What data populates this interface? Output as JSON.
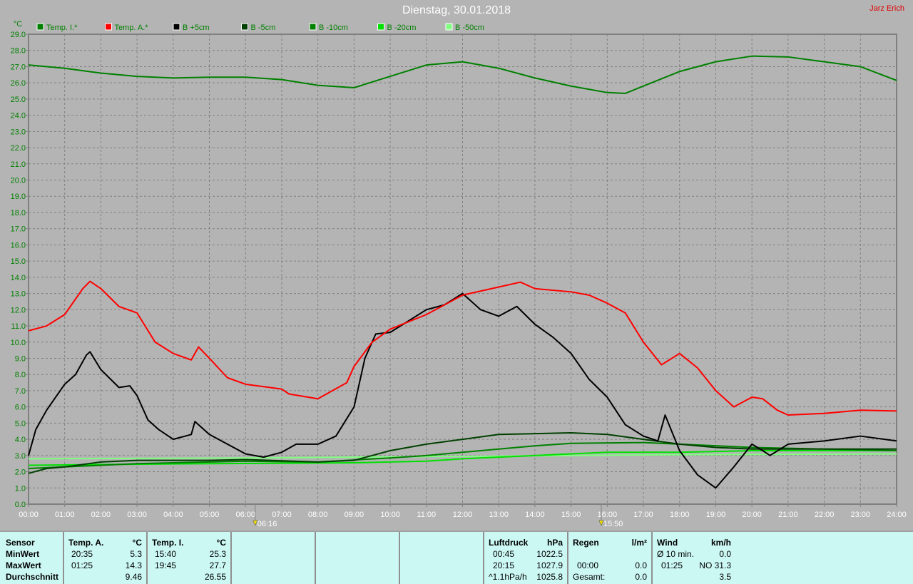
{
  "title": "Dienstag, 30.01.2018",
  "author": "Jarz Erich",
  "chart_data": {
    "type": "line",
    "ylabel": "°C",
    "ylim": [
      0,
      29
    ],
    "xlim": [
      0,
      24
    ],
    "yticks": [
      "0.0",
      "1.0",
      "2.0",
      "3.0",
      "4.0",
      "5.0",
      "6.0",
      "7.0",
      "8.0",
      "9.0",
      "10.0",
      "11.0",
      "12.0",
      "13.0",
      "14.0",
      "15.0",
      "16.0",
      "17.0",
      "18.0",
      "19.0",
      "20.0",
      "21.0",
      "22.0",
      "23.0",
      "24.0",
      "25.0",
      "26.0",
      "27.0",
      "28.0",
      "29.0"
    ],
    "xticks": [
      "00:00",
      "01:00",
      "02:00",
      "03:00",
      "04:00",
      "05:00",
      "06:00",
      "07:00",
      "08:00",
      "09:00",
      "10:00",
      "11:00",
      "12:00",
      "13:00",
      "14:00",
      "15:00",
      "16:00",
      "17:00",
      "18:00",
      "19:00",
      "20:00",
      "21:00",
      "22:00",
      "23:00",
      "24:00"
    ],
    "grid": true,
    "legend_position": "top",
    "markers": [
      {
        "label": "06:16",
        "x": 6.267,
        "type": "sunrise"
      },
      {
        "label": "15:50",
        "x": 15.833,
        "type": "sunset"
      }
    ],
    "series": [
      {
        "name": "Temp. I.*",
        "color": "#008000",
        "points": [
          [
            0,
            27.1
          ],
          [
            1,
            26.9
          ],
          [
            2,
            26.6
          ],
          [
            3,
            26.4
          ],
          [
            4,
            26.3
          ],
          [
            5,
            26.35
          ],
          [
            6,
            26.35
          ],
          [
            7,
            26.2
          ],
          [
            8,
            25.85
          ],
          [
            9,
            25.7
          ],
          [
            10,
            26.4
          ],
          [
            11,
            27.1
          ],
          [
            12,
            27.3
          ],
          [
            13,
            26.9
          ],
          [
            14,
            26.3
          ],
          [
            15,
            25.8
          ],
          [
            16,
            25.4
          ],
          [
            16.5,
            25.35
          ],
          [
            17,
            25.8
          ],
          [
            18,
            26.7
          ],
          [
            19,
            27.3
          ],
          [
            20,
            27.65
          ],
          [
            21,
            27.6
          ],
          [
            22,
            27.3
          ],
          [
            23,
            27.0
          ],
          [
            24,
            26.15
          ]
        ]
      },
      {
        "name": "Temp. A.*",
        "color": "#ff0000",
        "points": [
          [
            0,
            10.7
          ],
          [
            0.5,
            11.0
          ],
          [
            1,
            11.7
          ],
          [
            1.5,
            13.3
          ],
          [
            1.7,
            13.75
          ],
          [
            2,
            13.3
          ],
          [
            2.5,
            12.2
          ],
          [
            3,
            11.8
          ],
          [
            3.5,
            10.0
          ],
          [
            4,
            9.3
          ],
          [
            4.5,
            8.9
          ],
          [
            4.7,
            9.7
          ],
          [
            5,
            9.0
          ],
          [
            5.5,
            7.8
          ],
          [
            6,
            7.4
          ],
          [
            7,
            7.1
          ],
          [
            7.2,
            6.8
          ],
          [
            8,
            6.5
          ],
          [
            8.8,
            7.5
          ],
          [
            9,
            8.5
          ],
          [
            9.5,
            10.0
          ],
          [
            10,
            10.8
          ],
          [
            11,
            11.7
          ],
          [
            12,
            12.9
          ],
          [
            13,
            13.4
          ],
          [
            13.6,
            13.7
          ],
          [
            14,
            13.3
          ],
          [
            15,
            13.1
          ],
          [
            15.5,
            12.9
          ],
          [
            16,
            12.4
          ],
          [
            16.5,
            11.8
          ],
          [
            17,
            10.0
          ],
          [
            17.5,
            8.6
          ],
          [
            18,
            9.3
          ],
          [
            18.5,
            8.4
          ],
          [
            19,
            7.0
          ],
          [
            19.5,
            6.0
          ],
          [
            20,
            6.6
          ],
          [
            20.3,
            6.5
          ],
          [
            20.7,
            5.8
          ],
          [
            21,
            5.5
          ],
          [
            22,
            5.6
          ],
          [
            23,
            5.8
          ],
          [
            24,
            5.75
          ]
        ]
      },
      {
        "name": "B +5cm",
        "color": "#000000",
        "points": [
          [
            0,
            3.0
          ],
          [
            0.2,
            4.6
          ],
          [
            0.5,
            5.8
          ],
          [
            1,
            7.4
          ],
          [
            1.3,
            8.0
          ],
          [
            1.6,
            9.2
          ],
          [
            1.7,
            9.4
          ],
          [
            2,
            8.3
          ],
          [
            2.5,
            7.2
          ],
          [
            2.8,
            7.3
          ],
          [
            3,
            6.7
          ],
          [
            3.3,
            5.2
          ],
          [
            3.6,
            4.6
          ],
          [
            4,
            4.0
          ],
          [
            4.5,
            4.3
          ],
          [
            4.6,
            5.1
          ],
          [
            5,
            4.3
          ],
          [
            5.5,
            3.7
          ],
          [
            6,
            3.1
          ],
          [
            6.5,
            2.9
          ],
          [
            7,
            3.2
          ],
          [
            7.4,
            3.7
          ],
          [
            8,
            3.7
          ],
          [
            8.5,
            4.2
          ],
          [
            9,
            6.0
          ],
          [
            9.3,
            9.0
          ],
          [
            9.6,
            10.5
          ],
          [
            10,
            10.6
          ],
          [
            11,
            12.0
          ],
          [
            11.5,
            12.3
          ],
          [
            12,
            13.0
          ],
          [
            12.5,
            12.0
          ],
          [
            13,
            11.6
          ],
          [
            13.5,
            12.2
          ],
          [
            14,
            11.1
          ],
          [
            14.5,
            10.3
          ],
          [
            15,
            9.3
          ],
          [
            15.5,
            7.7
          ],
          [
            16,
            6.6
          ],
          [
            16.5,
            4.9
          ],
          [
            17,
            4.2
          ],
          [
            17.4,
            3.9
          ],
          [
            17.6,
            5.5
          ],
          [
            18,
            3.3
          ],
          [
            18.5,
            1.8
          ],
          [
            19,
            1.0
          ],
          [
            19.5,
            2.3
          ],
          [
            20,
            3.7
          ],
          [
            20.3,
            3.3
          ],
          [
            20.5,
            3.0
          ],
          [
            21,
            3.7
          ],
          [
            22,
            3.9
          ],
          [
            23,
            4.2
          ],
          [
            24,
            3.9
          ]
        ]
      },
      {
        "name": "B -5cm",
        "color": "#004000",
        "points": [
          [
            0,
            1.9
          ],
          [
            0.5,
            2.2
          ],
          [
            1,
            2.3
          ],
          [
            2,
            2.6
          ],
          [
            3,
            2.7
          ],
          [
            5,
            2.7
          ],
          [
            6,
            2.75
          ],
          [
            8,
            2.6
          ],
          [
            9,
            2.7
          ],
          [
            10,
            3.3
          ],
          [
            11,
            3.7
          ],
          [
            12,
            4.0
          ],
          [
            13,
            4.3
          ],
          [
            15,
            4.4
          ],
          [
            16,
            4.3
          ],
          [
            17,
            4.0
          ],
          [
            18,
            3.7
          ],
          [
            19,
            3.5
          ],
          [
            20,
            3.4
          ],
          [
            22,
            3.4
          ],
          [
            24,
            3.4
          ]
        ]
      },
      {
        "name": "B -10cm",
        "color": "#008000",
        "points": [
          [
            0,
            2.2
          ],
          [
            3,
            2.5
          ],
          [
            6,
            2.65
          ],
          [
            8,
            2.6
          ],
          [
            10,
            2.85
          ],
          [
            11,
            3.0
          ],
          [
            12,
            3.2
          ],
          [
            13,
            3.4
          ],
          [
            14,
            3.6
          ],
          [
            15,
            3.75
          ],
          [
            17,
            3.8
          ],
          [
            18,
            3.7
          ],
          [
            20,
            3.5
          ],
          [
            24,
            3.3
          ]
        ]
      },
      {
        "name": "B -20cm",
        "color": "#00e000",
        "points": [
          [
            0,
            2.4
          ],
          [
            5,
            2.5
          ],
          [
            9,
            2.55
          ],
          [
            11,
            2.65
          ],
          [
            12,
            2.8
          ],
          [
            14,
            3.0
          ],
          [
            15,
            3.1
          ],
          [
            16,
            3.2
          ],
          [
            18,
            3.2
          ],
          [
            20,
            3.3
          ],
          [
            24,
            3.3
          ]
        ]
      },
      {
        "name": "B -50cm",
        "color": "#80ff80",
        "points": [
          [
            0,
            2.8
          ],
          [
            6,
            2.85
          ],
          [
            12,
            2.95
          ],
          [
            18,
            3.05
          ],
          [
            24,
            3.1
          ]
        ]
      }
    ]
  },
  "table": {
    "sensor": {
      "h": "Sensor",
      "min": "MinWert",
      "max": "MaxWert",
      "avg": "Durchschnitt"
    },
    "tempA": {
      "h": "Temp. A.",
      "u": "°C",
      "min_t": "20:35",
      "min": "5.3",
      "max_t": "01:25",
      "max": "14.3",
      "avg": "9.46"
    },
    "tempI": {
      "h": "Temp. I.",
      "u": "°C",
      "min_t": "15:40",
      "min": "25.3",
      "max_t": "19:45",
      "max": "27.7",
      "avg": "26.55"
    },
    "luft": {
      "h": "Luftdruck",
      "u": "hPa",
      "min_t": "00:45",
      "min": "1022.5",
      "max_t": "20:15",
      "max": "1027.9",
      "avg_t": "^1.1hPa/h",
      "avg": "1025.8"
    },
    "regen": {
      "h": "Regen",
      "u": "l/m²",
      "max_t": "00:00",
      "max": "0.0",
      "avg_t": "Gesamt:",
      "avg": "0.0"
    },
    "wind": {
      "h": "Wind",
      "u": "km/h",
      "min_t": "Ø 10 min.",
      "min": "0.0",
      "max_t": "01:25",
      "max": "NO 31.3",
      "avg": "3.5"
    }
  }
}
